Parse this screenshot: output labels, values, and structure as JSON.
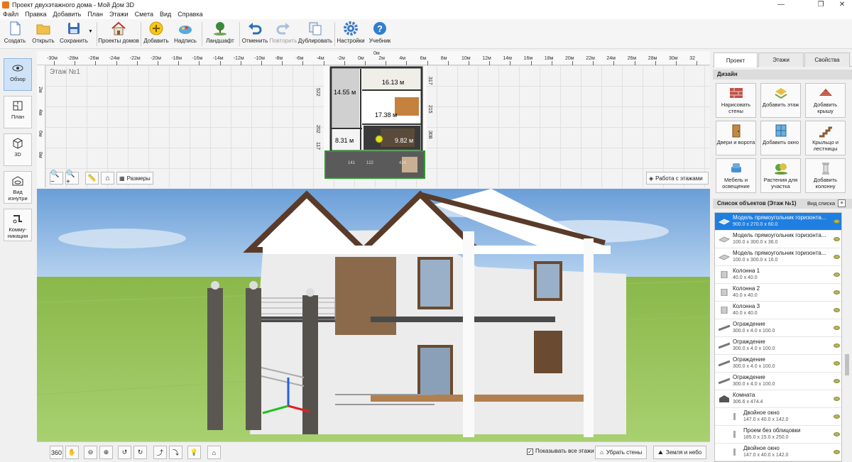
{
  "window": {
    "title": "Проект двухэтажного дома - Мой Дом 3D"
  },
  "menu": [
    "Файл",
    "Правка",
    "Добавить",
    "План",
    "Этажи",
    "Смета",
    "Вид",
    "Справка"
  ],
  "toolbar": {
    "create": "Создать",
    "open": "Открыть",
    "save": "Сохранить",
    "house_projects": "Проекты домов",
    "add": "Добавить",
    "label": "Надпись",
    "landscape": "Ландшафт",
    "undo": "Отменить",
    "redo": "Повторить",
    "duplicate": "Дублировать",
    "settings": "Настройки",
    "tutorial": "Учебник"
  },
  "leftbar": [
    "Обзор",
    "План",
    "3D",
    "Вид изнутри",
    "Комму-никации"
  ],
  "plan": {
    "floor_label": "Этаж №1",
    "ruler_top": [
      "-30м",
      "-28м",
      "-26м",
      "-24м",
      "-22м",
      "-20м",
      "-18м",
      "-16м",
      "-14м",
      "-12м",
      "-10м",
      "-8м",
      "-6м",
      "-4м",
      "-2м",
      "0м",
      "2м",
      "4м",
      "6м",
      "8м",
      "10м",
      "12м",
      "14м",
      "16м",
      "18м",
      "20м",
      "22м",
      "24м",
      "26м",
      "28м",
      "30м",
      "32"
    ],
    "ruler_top_extra": "0м",
    "ruler_left": [
      "2м",
      "4м",
      "6м",
      "8м"
    ],
    "rooms": {
      "r1": "14.55 м",
      "r2": "16.13 м",
      "r3": "17.38 м",
      "r4": "8.31 м",
      "r5": "9.82 м"
    },
    "dims": {
      "d1": "317",
      "d2": "215",
      "d3": "308",
      "d4": "522",
      "d5": "202",
      "d6": "117",
      "d7": "141",
      "d8": "122",
      "d9": "424"
    },
    "sizes_btn": "Размеры",
    "floors_btn": "Работа с этажами"
  },
  "bottombar": {
    "show_all": "Показывать все этажи",
    "remove_walls": "Убрать стены",
    "ground_sky": "Земля и небо"
  },
  "right": {
    "tabs": [
      "Проект",
      "Этажи",
      "Свойства"
    ],
    "design_title": "Дизайн",
    "design": [
      "Нарисовать стены",
      "Добавить этаж",
      "Добавить крышу",
      "Двери и ворота",
      "Добавить окно",
      "Крыльцо и лестницы",
      "Мебель и освещение",
      "Растения для участка",
      "Добавить колонну"
    ],
    "list_title": "Список объектов (Этаж №1)",
    "list_view": "Вид списка",
    "objects": [
      {
        "name": "Модель прямоугольник горизонта...",
        "dims": "900.0 x 270.0 x 60.0"
      },
      {
        "name": "Модель прямоугольник горизонта...",
        "dims": "100.0 x 300.0 x 36.0"
      },
      {
        "name": "Модель прямоугольник горизонта...",
        "dims": "100.0 x 300.0 x 16.0"
      },
      {
        "name": "Колонна 1",
        "dims": "40.0 x 40.0"
      },
      {
        "name": "Колонна 2",
        "dims": "40.0 x 40.0"
      },
      {
        "name": "Колонна 3",
        "dims": "40.0 x 40.0"
      },
      {
        "name": "Ограждение",
        "dims": "300.0 x 4.0 x 100.0"
      },
      {
        "name": "Ограждение",
        "dims": "300.0 x 4.0 x 100.0"
      },
      {
        "name": "Ограждение",
        "dims": "300.0 x 4.0 x 100.0"
      },
      {
        "name": "Ограждение",
        "dims": "300.0 x 4.0 x 100.0"
      },
      {
        "name": "Комната",
        "dims": "306.6 x 474.4"
      },
      {
        "name": "Двойное окно",
        "dims": "147.0 x 40.0 x 142.0"
      },
      {
        "name": "Проем без облицовки",
        "dims": "185.0 x 15.0 x 250.0"
      },
      {
        "name": "Двойное окно",
        "dims": "147.0 x 40.0 x 142.0"
      }
    ]
  }
}
